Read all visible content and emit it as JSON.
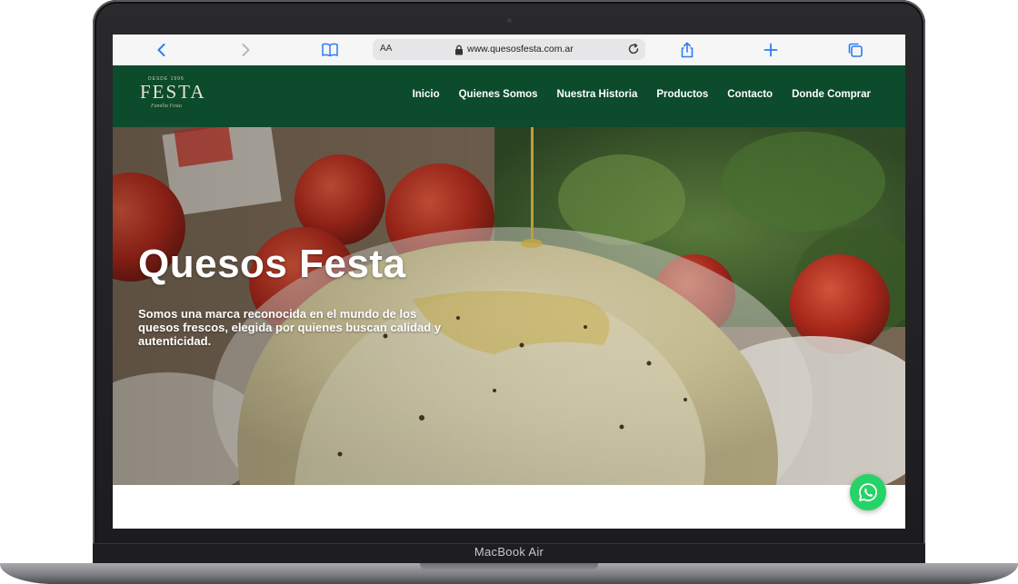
{
  "device": {
    "label": "MacBook Air"
  },
  "browser": {
    "text_size_label": "AA",
    "url": "www.quesosfesta.com.ar",
    "icons": [
      "back-icon",
      "forward-icon",
      "bookmarks-icon",
      "lock-icon",
      "reload-icon",
      "share-icon",
      "new-tab-icon",
      "tabs-icon"
    ]
  },
  "site": {
    "logo": {
      "small": "DESDE 1996",
      "main": "FESTA",
      "script": "Familia Festa"
    },
    "nav": [
      "Inicio",
      "Quienes Somos",
      "Nuestra Historia",
      "Productos",
      "Contacto",
      "Donde Comprar"
    ],
    "hero": {
      "title": "Quesos Festa",
      "subtitle": "Somos una marca reconocida en el mundo de los quesos frescos, elegida por quienes buscan calidad y autenticidad."
    },
    "floating_button": "whatsapp-icon"
  },
  "colors": {
    "header_bg": "#0c4b2c",
    "accent_blue": "#2b7cf6",
    "whatsapp": "#25d366"
  }
}
